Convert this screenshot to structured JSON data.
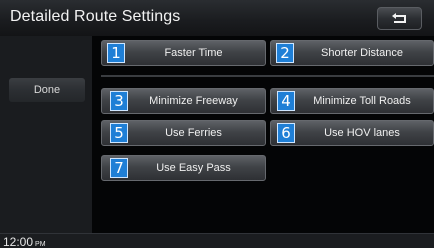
{
  "window": {
    "title": "Detailed Route Settings",
    "back_icon": "return-arrow-icon"
  },
  "sidebar": {
    "done_label": "Done"
  },
  "options": [
    {
      "number": "1",
      "label": "Faster Time"
    },
    {
      "number": "2",
      "label": "Shorter Distance"
    },
    {
      "number": "3",
      "label": "Minimize Freeway"
    },
    {
      "number": "4",
      "label": "Minimize Toll Roads"
    },
    {
      "number": "5",
      "label": "Use Ferries"
    },
    {
      "number": "6",
      "label": "Use HOV lanes"
    },
    {
      "number": "7",
      "label": "Use Easy Pass"
    }
  ],
  "status": {
    "time": "12:00",
    "ampm": "PM"
  },
  "colors": {
    "badge": "#1f7fd6",
    "background": "#07090c"
  }
}
